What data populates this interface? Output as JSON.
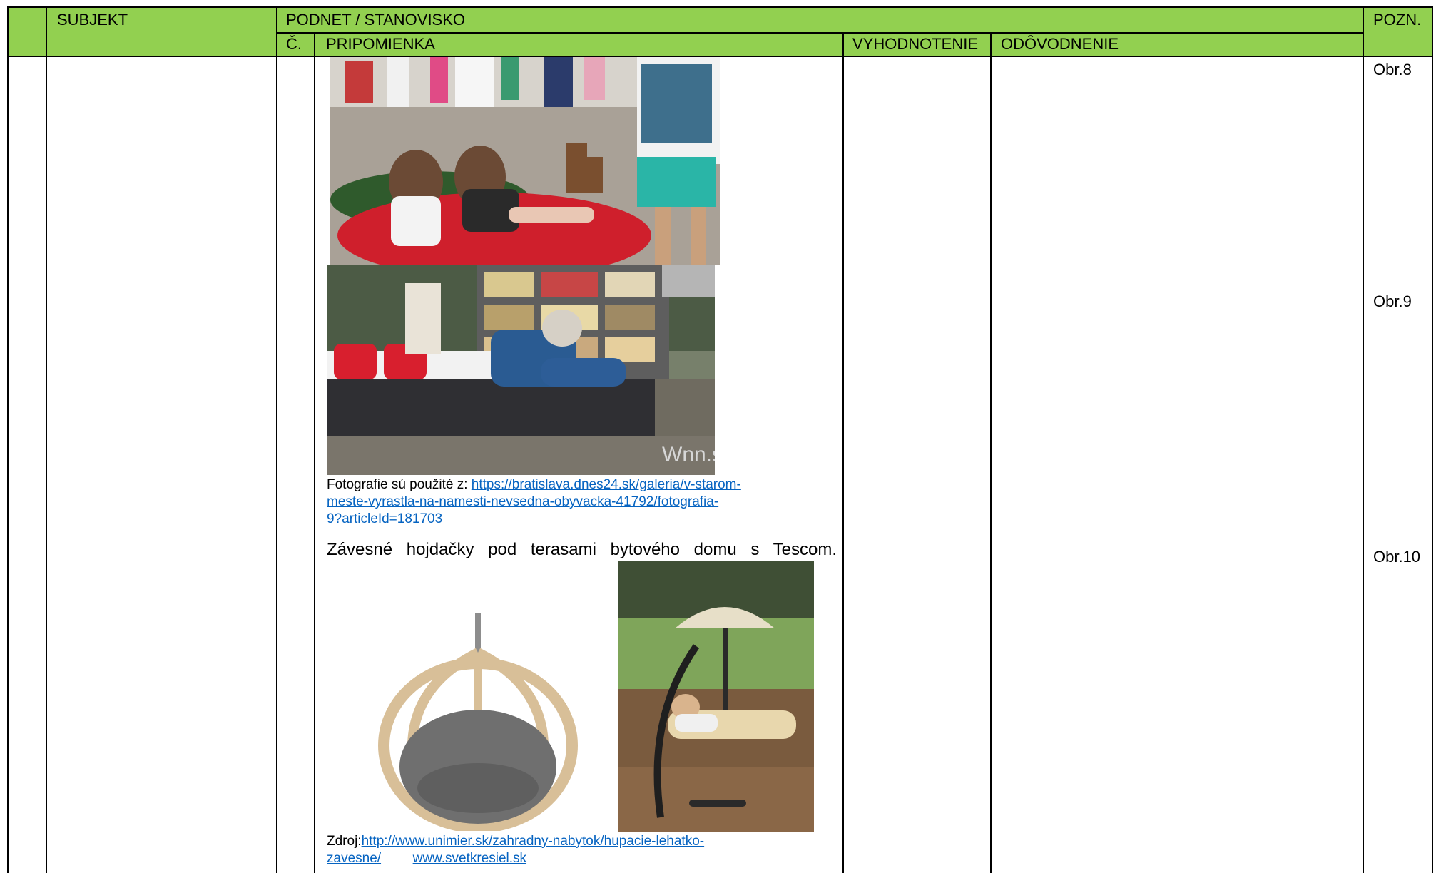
{
  "header": {
    "subject": "SUBJEKT",
    "podnet": "PODNET / STANOVISKO",
    "pozn": "POZN.",
    "cislo": "Č.",
    "pripomienka": "PRIPOMIENKA",
    "vyhodnotenie": "VYHODNOTENIE",
    "odovodnenie": "ODÔVODNENIE"
  },
  "notes": {
    "obr8": "Obr.8",
    "obr9": "Obr.9",
    "obr10": "Obr.10"
  },
  "content": {
    "photo_source_prefix": "Fotografie sú použité z:",
    "photo_source_link_1": "https://bratislava.dnes24.sk/galeria/v-starom-",
    "photo_source_link_2": "meste-vyrastla-na-namesti-nevsedna-obyvacka-41792/fotografia-",
    "photo_source_link_3": "9?articleId=181703",
    "hammock_text": "Závesné hojdačky pod terasami bytového domu s Tescom.",
    "zdroj_prefix": "Zdroj:",
    "zdroj_link_1": "http://www.unimier.sk/zahradny-nabytok/hupacie-lehatko-",
    "zdroj_link_2": "zavesne/",
    "zdroj_link_3": "www.svetkresiel.sk"
  },
  "colors": {
    "header_bg": "#92d050",
    "link": "#0563c1"
  }
}
